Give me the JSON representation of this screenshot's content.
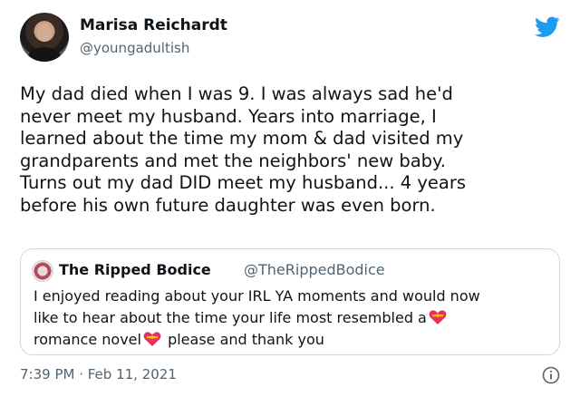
{
  "author": {
    "name": "Marisa Reichardt",
    "handle": "@youngadultish"
  },
  "tweet": {
    "lines": [
      "My dad died when I was 9. I was always sad he'd",
      "never meet my husband. Years into marriage, I",
      "learned about the time my mom & dad visited my",
      "grandparents and met the neighbors' new baby.",
      "Turns out my dad DID meet my husband... 4 years",
      "before his own future daughter was even born."
    ]
  },
  "quoted": {
    "name": "The Ripped Bodice",
    "handle": "@TheRippedBodice",
    "line1": "I enjoyed reading about your IRL YA  moments and would now",
    "line2": "like to hear about the time your life most resembled a",
    "line3a": "romance novel",
    "line3b": "please and thank you"
  },
  "meta": {
    "time": "7:39 PM · Feb 11, 2021"
  },
  "icons": {
    "platform": "twitter-bird-icon",
    "info": "info-icon",
    "emoji": "heart-with-ribbon-icon"
  },
  "colors": {
    "twitter_blue": "#1d9bf0",
    "muted_text": "#536471",
    "border": "#cfd9de"
  }
}
